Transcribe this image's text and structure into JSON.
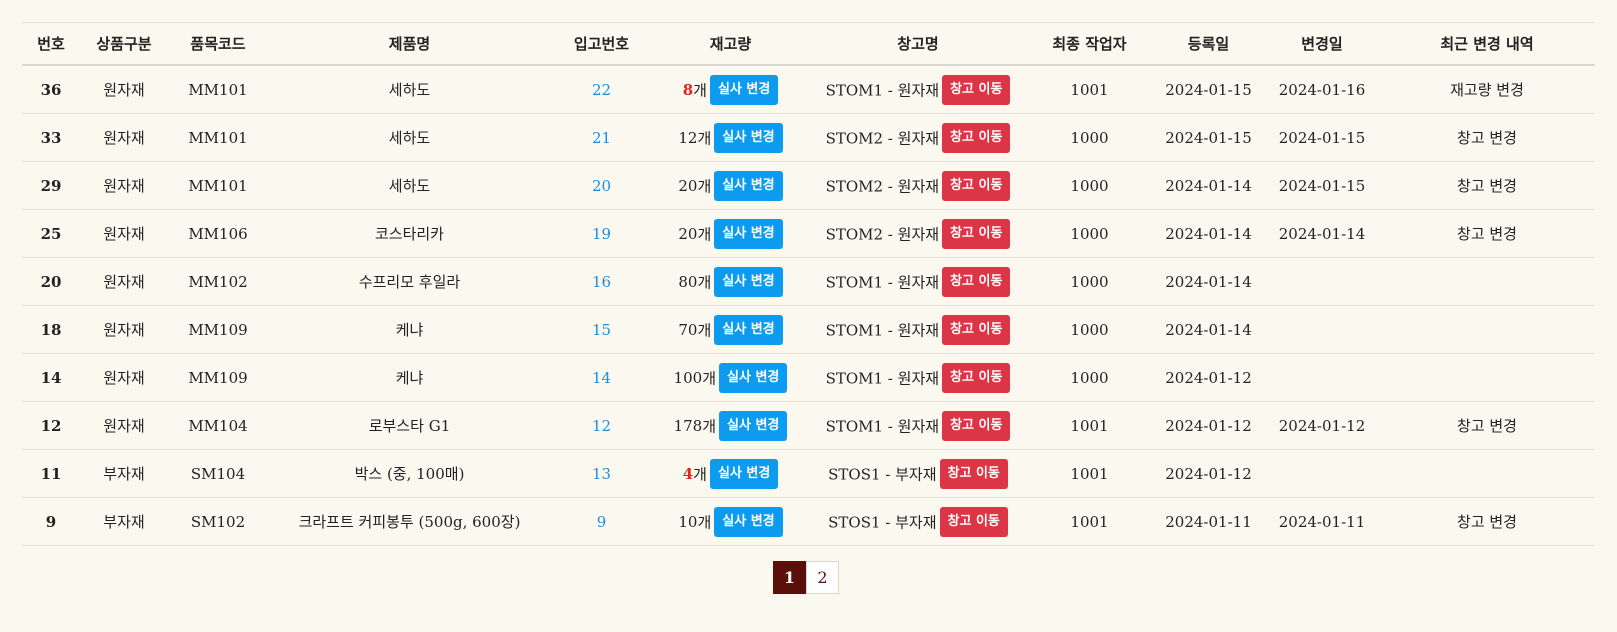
{
  "table": {
    "headers": [
      "번호",
      "상품구분",
      "품목코드",
      "제품명",
      "입고번호",
      "재고량",
      "창고명",
      "최종 작업자",
      "등록일",
      "변경일",
      "최근 변경 내역"
    ],
    "qty_unit": "개",
    "adjust_label": "실사 변경",
    "move_label": "창고 이동",
    "rows": [
      {
        "no": "36",
        "category": "원자재",
        "code": "MM101",
        "name": "세하도",
        "inbound": "22",
        "qty": "8",
        "low": true,
        "warehouse": "STOM1 - 원자재",
        "worker": "1001",
        "registered": "2024-01-15",
        "changed": "2024-01-16",
        "history": "재고량 변경"
      },
      {
        "no": "33",
        "category": "원자재",
        "code": "MM101",
        "name": "세하도",
        "inbound": "21",
        "qty": "12",
        "low": false,
        "warehouse": "STOM2 - 원자재",
        "worker": "1000",
        "registered": "2024-01-15",
        "changed": "2024-01-15",
        "history": "창고 변경"
      },
      {
        "no": "29",
        "category": "원자재",
        "code": "MM101",
        "name": "세하도",
        "inbound": "20",
        "qty": "20",
        "low": false,
        "warehouse": "STOM2 - 원자재",
        "worker": "1000",
        "registered": "2024-01-14",
        "changed": "2024-01-15",
        "history": "창고 변경"
      },
      {
        "no": "25",
        "category": "원자재",
        "code": "MM106",
        "name": "코스타리카",
        "inbound": "19",
        "qty": "20",
        "low": false,
        "warehouse": "STOM2 - 원자재",
        "worker": "1000",
        "registered": "2024-01-14",
        "changed": "2024-01-14",
        "history": "창고 변경"
      },
      {
        "no": "20",
        "category": "원자재",
        "code": "MM102",
        "name": "수프리모 후일라",
        "inbound": "16",
        "qty": "80",
        "low": false,
        "warehouse": "STOM1 - 원자재",
        "worker": "1000",
        "registered": "2024-01-14",
        "changed": "",
        "history": ""
      },
      {
        "no": "18",
        "category": "원자재",
        "code": "MM109",
        "name": "케냐",
        "inbound": "15",
        "qty": "70",
        "low": false,
        "warehouse": "STOM1 - 원자재",
        "worker": "1000",
        "registered": "2024-01-14",
        "changed": "",
        "history": ""
      },
      {
        "no": "14",
        "category": "원자재",
        "code": "MM109",
        "name": "케냐",
        "inbound": "14",
        "qty": "100",
        "low": false,
        "warehouse": "STOM1 - 원자재",
        "worker": "1000",
        "registered": "2024-01-12",
        "changed": "",
        "history": ""
      },
      {
        "no": "12",
        "category": "원자재",
        "code": "MM104",
        "name": "로부스타 G1",
        "inbound": "12",
        "qty": "178",
        "low": false,
        "warehouse": "STOM1 - 원자재",
        "worker": "1001",
        "registered": "2024-01-12",
        "changed": "2024-01-12",
        "history": "창고 변경"
      },
      {
        "no": "11",
        "category": "부자재",
        "code": "SM104",
        "name": "박스 (중, 100매)",
        "inbound": "13",
        "qty": "4",
        "low": true,
        "warehouse": "STOS1 - 부자재",
        "worker": "1001",
        "registered": "2024-01-12",
        "changed": "",
        "history": ""
      },
      {
        "no": "9",
        "category": "부자재",
        "code": "SM102",
        "name": "크라프트 커피봉투 (500g, 600장)",
        "inbound": "9",
        "qty": "10",
        "low": false,
        "warehouse": "STOS1 - 부자재",
        "worker": "1001",
        "registered": "2024-01-11",
        "changed": "2024-01-11",
        "history": "창고 변경"
      }
    ]
  },
  "pagination": {
    "pages": [
      "1",
      "2"
    ],
    "current": "1"
  },
  "colors": {
    "background": "#fbf8ef",
    "link_blue": "#1a8fe0",
    "low_stock_red": "#e1251b",
    "adjust_button": "#0d9bef",
    "move_button": "#dc3545",
    "active_page": "#5c0e0a"
  }
}
